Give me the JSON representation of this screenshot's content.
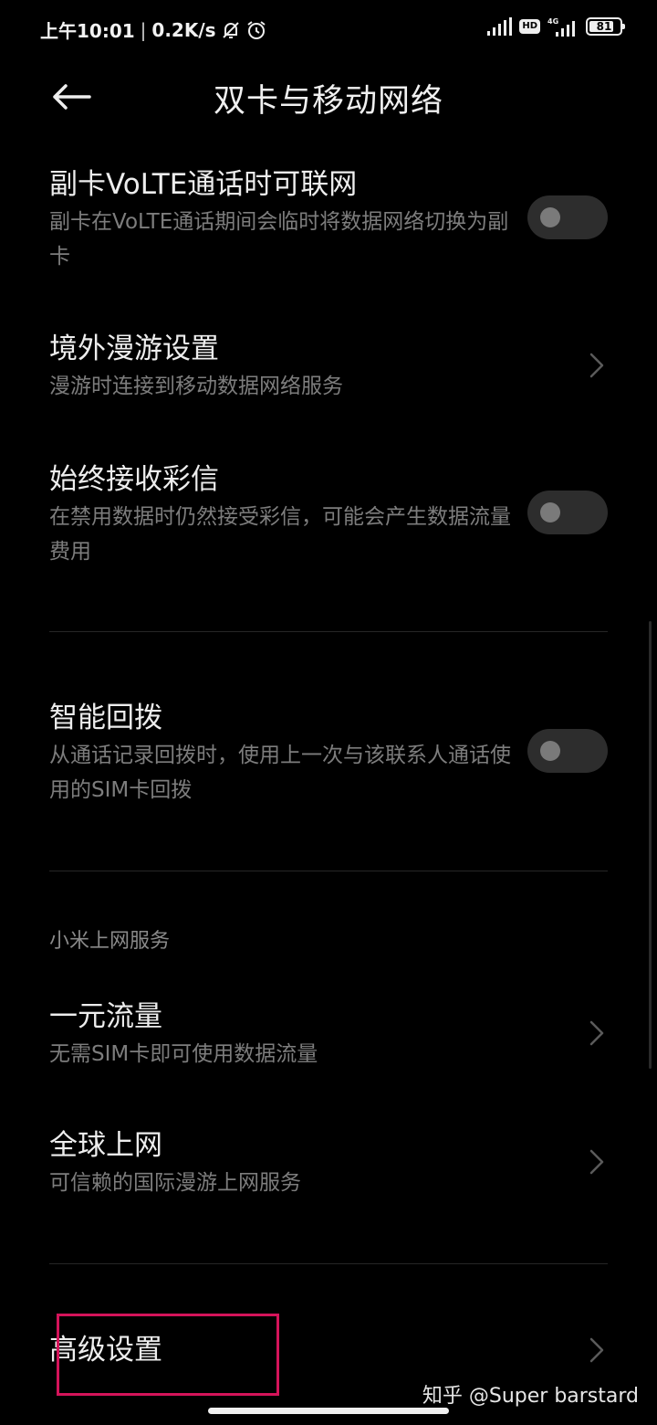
{
  "status_bar": {
    "time": "上午10:01",
    "speed": "0.2K/s",
    "hd_label": "HD",
    "network_label": "4G",
    "battery_level": 81,
    "battery_text": "81",
    "icons": [
      "mute-bell-icon",
      "alarm-icon",
      "signal-icon",
      "hd-icon",
      "signal-4g-icon",
      "battery-icon"
    ]
  },
  "header": {
    "title": "双卡与移动网络",
    "back_icon": "arrow-left-icon"
  },
  "items": [
    {
      "title": "副卡VoLTE通话时可联网",
      "subtitle": "副卡在VoLTE通话期间会临时将数据网络切换为副卡",
      "control": "toggle",
      "enabled": false
    },
    {
      "title": "境外漫游设置",
      "subtitle": "漫游时连接到移动数据网络服务",
      "control": "chevron"
    },
    {
      "title": "始终接收彩信",
      "subtitle": "在禁用数据时仍然接受彩信，可能会产生数据流量费用",
      "control": "toggle",
      "enabled": false
    },
    {
      "title": "智能回拨",
      "subtitle": "从通话记录回拨时，使用上一次与该联系人通话使用的SIM卡回拨",
      "control": "toggle",
      "enabled": false
    },
    {
      "title": "一元流量",
      "subtitle": "无需SIM卡即可使用数据流量",
      "control": "chevron"
    },
    {
      "title": "全球上网",
      "subtitle": "可信赖的国际漫游上网服务",
      "control": "chevron"
    },
    {
      "title": "高级设置",
      "control": "chevron"
    }
  ],
  "section_xiaomi": {
    "label": "小米上网服务"
  },
  "watermark": {
    "text": "知乎 @Super barstard"
  },
  "colors": {
    "background": "#000000",
    "title_text": "#ededed",
    "subtitle_text": "#7d7d7d",
    "toggle_off_track": "#2d2d2d",
    "highlight": "#d4145a"
  }
}
